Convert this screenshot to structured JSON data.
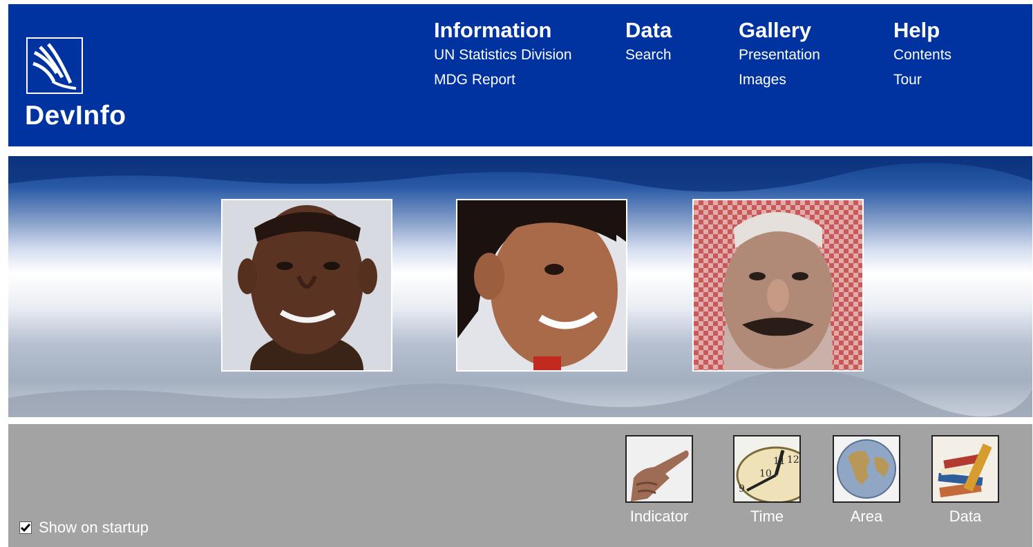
{
  "app": {
    "logo_text": "DevInfo",
    "colors": {
      "header": "#0033a0",
      "footer": "#a3a3a3",
      "text": "#ffffff"
    }
  },
  "nav": [
    {
      "title": "Information",
      "links": [
        "UN Statistics Division",
        "MDG Report"
      ]
    },
    {
      "title": "Data",
      "links": [
        "Search"
      ]
    },
    {
      "title": "Gallery",
      "links": [
        "Presentation",
        "Images"
      ]
    },
    {
      "title": "Help",
      "links": [
        "Contents",
        "Tour"
      ]
    }
  ],
  "banner": {
    "portraits": [
      "boy-portrait-photo",
      "girl-portrait-photo",
      "man-portrait-photo"
    ]
  },
  "tools": [
    {
      "label": "Indicator",
      "icon": "pointing-hand-icon"
    },
    {
      "label": "Time",
      "icon": "clock-icon"
    },
    {
      "label": "Area",
      "icon": "globe-icon"
    },
    {
      "label": "Data",
      "icon": "books-icon"
    }
  ],
  "startup": {
    "label": "Show on startup",
    "checked": true
  }
}
